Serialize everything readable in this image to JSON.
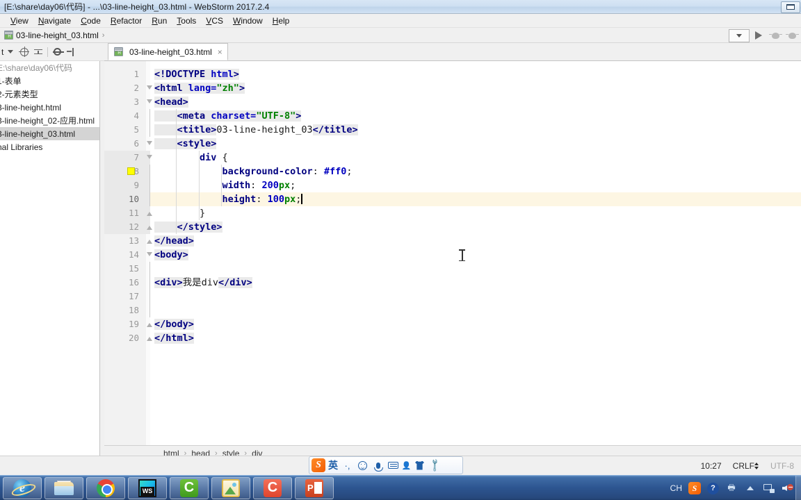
{
  "window": {
    "title": "[E:\\share\\day06\\代码] - ...\\03-line-height_03.html - WebStorm 2017.2.4",
    "restore_label": "Restore"
  },
  "menubar": {
    "items": [
      "View",
      "Navigate",
      "Code",
      "Refactor",
      "Run",
      "Tools",
      "VCS",
      "Window",
      "Help"
    ]
  },
  "navbar": {
    "breadcrumb_file": "03-line-height_03.html",
    "separator": "›",
    "combo_label": "chevron-down-icon",
    "run_label": "run-icon",
    "debug_label": "debug-icon",
    "coverage_label": "coverage-icon"
  },
  "project_panel": {
    "toolbar_label": "t",
    "tree": [
      {
        "label": "E:\\share\\day06\\代码",
        "selected": false,
        "muted": true
      },
      {
        "label": "1-表单",
        "selected": false,
        "muted": false
      },
      {
        "label": "2-元素类型",
        "selected": false,
        "muted": false
      },
      {
        "label": "3-line-height.html",
        "selected": false,
        "muted": false
      },
      {
        "label": "3-line-height_02-应用.html",
        "selected": false,
        "muted": false
      },
      {
        "label": "3-line-height_03.html",
        "selected": true,
        "muted": false
      },
      {
        "label": "nal Libraries",
        "selected": false,
        "muted": false
      }
    ]
  },
  "editor_tabs": [
    {
      "label": "03-line-height_03.html",
      "close": "×",
      "active": true
    }
  ],
  "editor": {
    "current_line": 10,
    "gutter_color_swatch_line": 8,
    "gutter_swatch_color": "#ffff00",
    "lines": [
      {
        "n": "1",
        "tokens": [
          {
            "t": "<!DOCTYPE ",
            "c": "t-brk"
          },
          {
            "t": "html",
            "c": "t-attr"
          },
          {
            "t": ">",
            "c": "t-brk"
          }
        ],
        "indent": 0,
        "fold": ""
      },
      {
        "n": "2",
        "tokens": [
          {
            "t": "<html ",
            "c": "t-tag"
          },
          {
            "t": "lang=",
            "c": "t-attr"
          },
          {
            "t": "\"zh\"",
            "c": "t-str"
          },
          {
            "t": ">",
            "c": "t-tag"
          }
        ],
        "indent": 0,
        "fold": "open"
      },
      {
        "n": "3",
        "tokens": [
          {
            "t": "<head>",
            "c": "t-tag"
          }
        ],
        "indent": 0,
        "fold": "open"
      },
      {
        "n": "4",
        "tokens": [
          {
            "t": "    <meta ",
            "c": "t-tag"
          },
          {
            "t": "charset=",
            "c": "t-attr"
          },
          {
            "t": "\"UTF-8\"",
            "c": "t-str"
          },
          {
            "t": ">",
            "c": "t-tag"
          }
        ],
        "indent": 1,
        "fold": ""
      },
      {
        "n": "5",
        "tokens": [
          {
            "t": "    <title>",
            "c": "t-tag"
          },
          {
            "t": "03-line-height_03",
            "c": "t-txt"
          },
          {
            "t": "</title>",
            "c": "t-tag"
          }
        ],
        "indent": 1,
        "fold": ""
      },
      {
        "n": "6",
        "tokens": [
          {
            "t": "    <style>",
            "c": "t-tag"
          }
        ],
        "indent": 1,
        "fold": "open"
      },
      {
        "n": "7",
        "tokens": [
          {
            "t": "        div ",
            "c": "t-css-sel"
          },
          {
            "t": "{",
            "c": "t-punc"
          }
        ],
        "indent": 2,
        "fold": "open"
      },
      {
        "n": "8",
        "tokens": [
          {
            "t": "            background-color",
            "c": "t-css-prop"
          },
          {
            "t": ": ",
            "c": "t-punc"
          },
          {
            "t": "#ff0",
            "c": "t-css-val"
          },
          {
            "t": ";",
            "c": "t-punc"
          }
        ],
        "indent": 3,
        "fold": ""
      },
      {
        "n": "9",
        "tokens": [
          {
            "t": "            width",
            "c": "t-css-prop"
          },
          {
            "t": ": ",
            "c": "t-punc"
          },
          {
            "t": "200",
            "c": "t-num"
          },
          {
            "t": "px",
            "c": "t-unit"
          },
          {
            "t": ";",
            "c": "t-punc"
          }
        ],
        "indent": 3,
        "fold": ""
      },
      {
        "n": "10",
        "tokens": [
          {
            "t": "            height",
            "c": "t-css-prop"
          },
          {
            "t": ": ",
            "c": "t-punc"
          },
          {
            "t": "100",
            "c": "t-num"
          },
          {
            "t": "px",
            "c": "t-unit"
          },
          {
            "t": ";",
            "c": "t-punc"
          }
        ],
        "indent": 3,
        "fold": "",
        "caret": true
      },
      {
        "n": "11",
        "tokens": [
          {
            "t": "        }",
            "c": "t-punc"
          }
        ],
        "indent": 2,
        "fold": "close"
      },
      {
        "n": "12",
        "tokens": [
          {
            "t": "    </style>",
            "c": "t-tag"
          }
        ],
        "indent": 1,
        "fold": "close"
      },
      {
        "n": "13",
        "tokens": [
          {
            "t": "</head>",
            "c": "t-tag"
          }
        ],
        "indent": 0,
        "fold": "close"
      },
      {
        "n": "14",
        "tokens": [
          {
            "t": "<body>",
            "c": "t-tag"
          }
        ],
        "indent": 0,
        "fold": "open"
      },
      {
        "n": "15",
        "tokens": [],
        "indent": 0,
        "fold": ""
      },
      {
        "n": "16",
        "tokens": [
          {
            "t": "<div>",
            "c": "t-tag"
          },
          {
            "t": "我是div",
            "c": "t-txt"
          },
          {
            "t": "</div>",
            "c": "t-tag"
          }
        ],
        "indent": 0,
        "fold": ""
      },
      {
        "n": "17",
        "tokens": [],
        "indent": 0,
        "fold": ""
      },
      {
        "n": "18",
        "tokens": [],
        "indent": 0,
        "fold": ""
      },
      {
        "n": "19",
        "tokens": [
          {
            "t": "</body>",
            "c": "t-tag"
          }
        ],
        "indent": 0,
        "fold": "close"
      },
      {
        "n": "20",
        "tokens": [
          {
            "t": "</html>",
            "c": "t-tag"
          }
        ],
        "indent": 0,
        "fold": "close"
      }
    ]
  },
  "editor_breadcrumb": {
    "items": [
      "html",
      "head",
      "style",
      "div"
    ],
    "separator": "›"
  },
  "statusbar": {
    "time": "10:27",
    "line_separator": "CRLF",
    "encoding": "UTF-8"
  },
  "ime": {
    "logo": "S",
    "mode": "英",
    "items": [
      "punctuation-icon",
      "emoji-icon",
      "voice-input-icon",
      "soft-keyboard-icon",
      "user-icon",
      "skin-icon",
      "toolbox-icon"
    ]
  },
  "taskbar": {
    "apps": [
      {
        "name": "internet-explorer",
        "label": "e"
      },
      {
        "name": "file-explorer",
        "label": ""
      },
      {
        "name": "google-chrome",
        "label": ""
      },
      {
        "name": "webstorm",
        "label": "WS"
      },
      {
        "name": "green-app",
        "label": "C"
      },
      {
        "name": "picture-app",
        "label": ""
      },
      {
        "name": "red-app",
        "label": "C"
      },
      {
        "name": "powerpoint",
        "label": "P"
      }
    ],
    "tray": {
      "language": "CH",
      "sogou": "S",
      "help": "?",
      "items": [
        "network-icon",
        "volume-muted-icon",
        "show-hidden-icons"
      ]
    }
  },
  "colors": {
    "titlebar": "#cfe0f2",
    "chrome": "#f0f0f0",
    "editor_bg": "#ffffff",
    "current_line": "#fdf6e3",
    "selection": "#d4d4d4",
    "taskbar": "#2d5590",
    "tag": "#000080",
    "string": "#008000",
    "number": "#0000c0"
  }
}
